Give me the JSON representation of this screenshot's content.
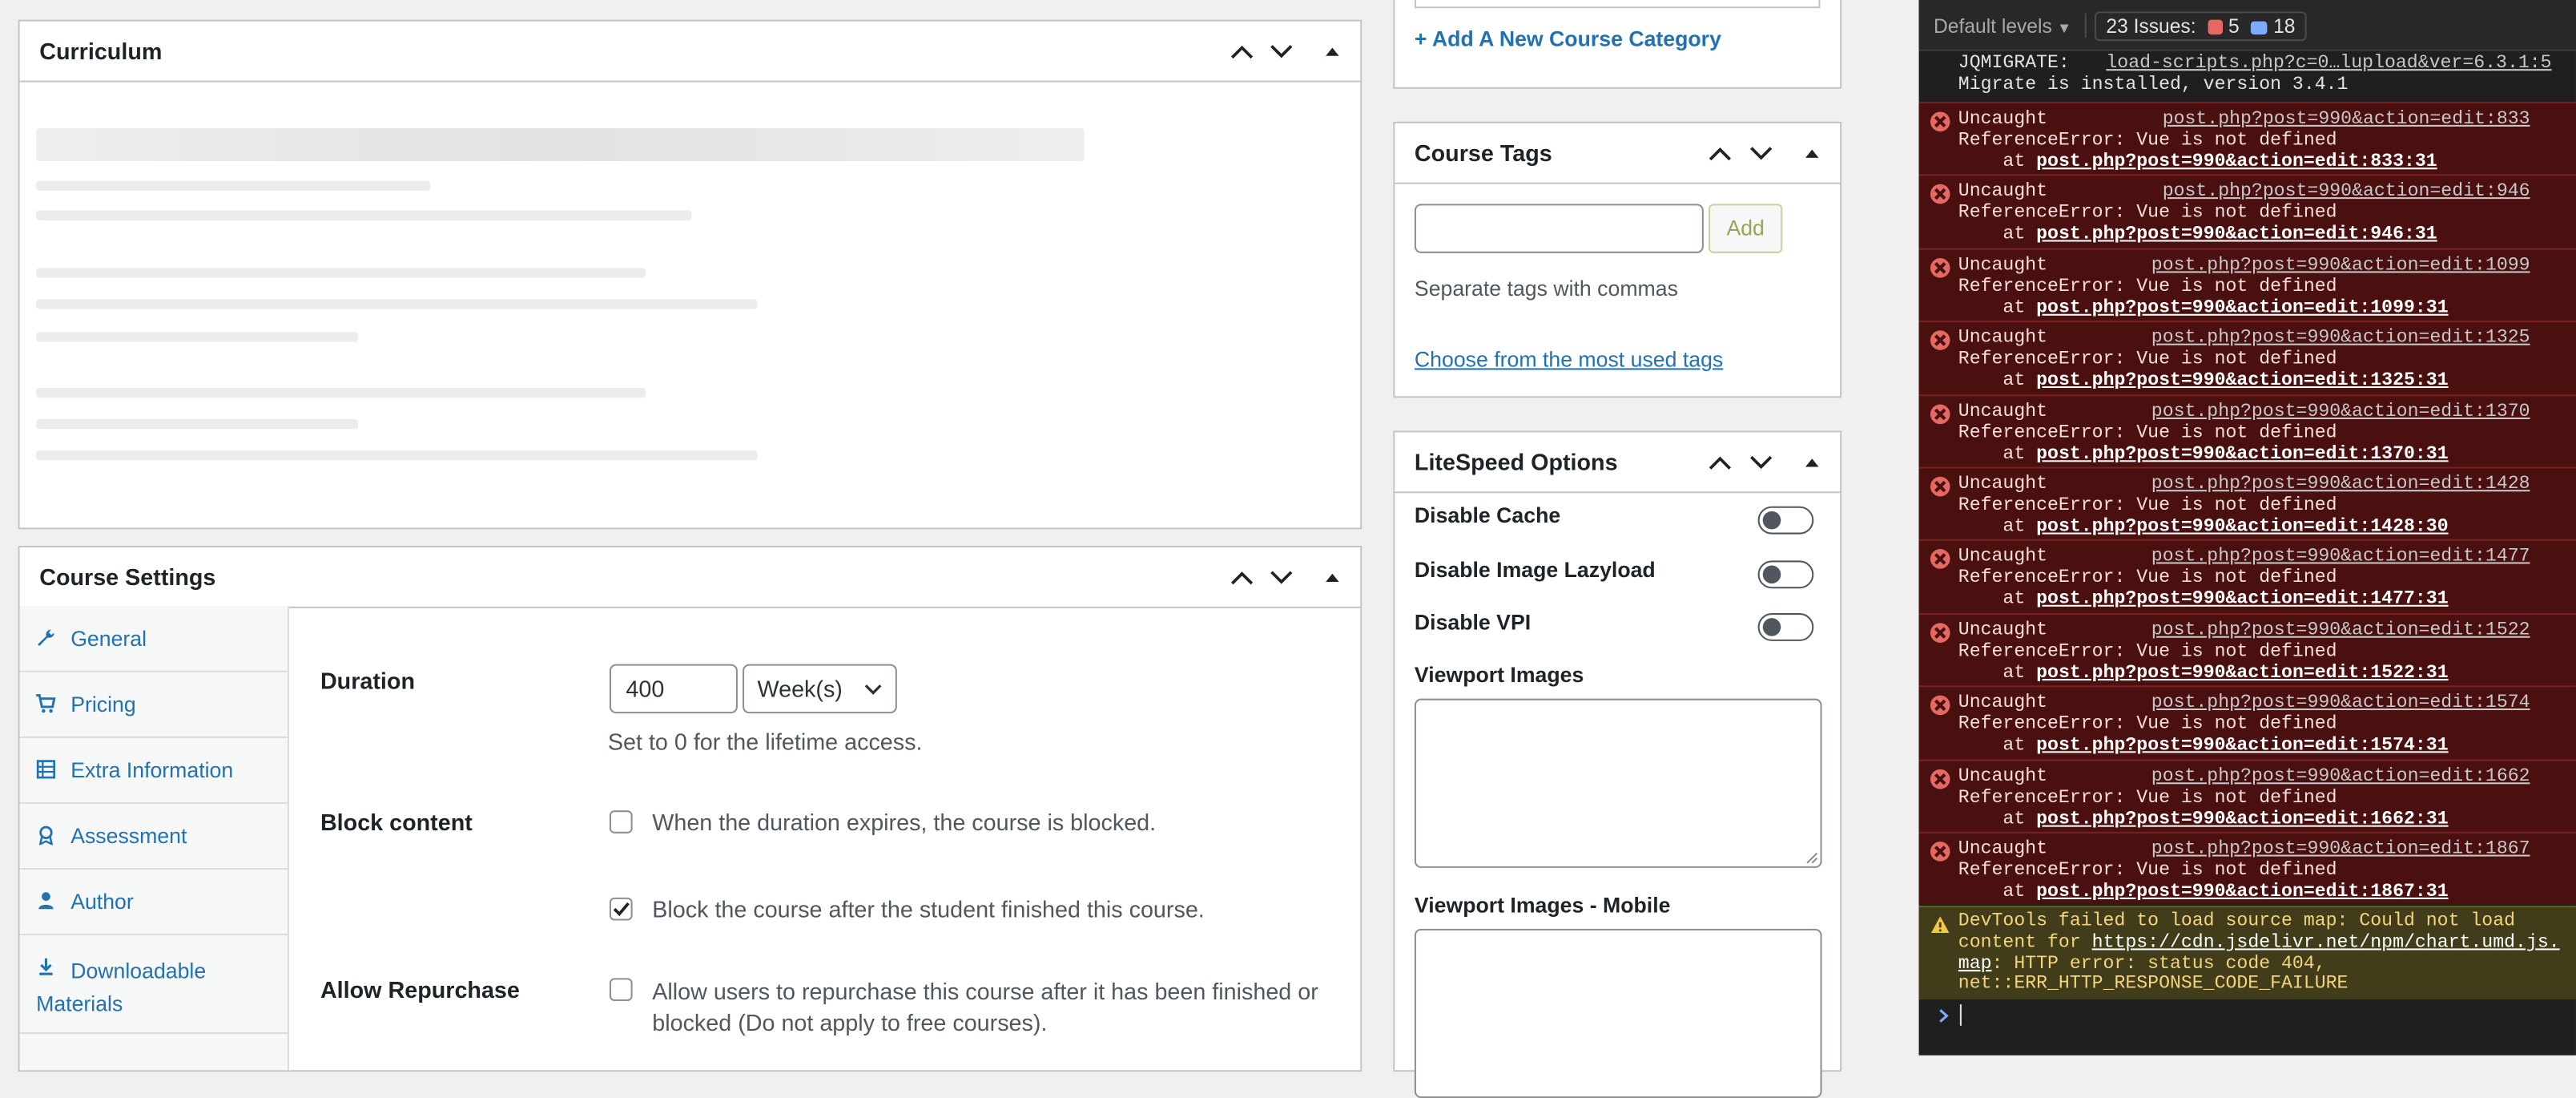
{
  "curriculum": {
    "title": "Curriculum"
  },
  "course_settings": {
    "title": "Course Settings",
    "tabs": [
      {
        "label": "General",
        "icon": "wrench-icon"
      },
      {
        "label": "Pricing",
        "icon": "cart-icon"
      },
      {
        "label": "Extra Information",
        "icon": "list-icon"
      },
      {
        "label": "Assessment",
        "icon": "award-icon"
      },
      {
        "label": "Author",
        "icon": "user-icon"
      },
      {
        "label": "Downloadable Materials",
        "icon": "download-icon"
      }
    ],
    "duration": {
      "label": "Duration",
      "value": "400",
      "unit": "Week(s)",
      "hint": "Set to 0 for the lifetime access."
    },
    "block_content": {
      "label": "Block content",
      "option1": "When the duration expires, the course is blocked.",
      "option1_checked": false,
      "option2": "Block the course after the student finished this course.",
      "option2_checked": true
    },
    "allow_repurchase": {
      "label": "Allow Repurchase",
      "text": "Allow users to repurchase this course after it has been finished or blocked (Do not apply to free courses).",
      "checked": false
    }
  },
  "category": {
    "add_link": "+ Add A New Course Category"
  },
  "course_tags": {
    "title": "Course Tags",
    "input_value": "",
    "add_button": "Add",
    "hint": "Separate tags with commas",
    "choose_link": "Choose from the most used tags"
  },
  "litespeed": {
    "title": "LiteSpeed Options",
    "toggles": [
      {
        "label": "Disable Cache",
        "on": false
      },
      {
        "label": "Disable Image Lazyload",
        "on": false
      },
      {
        "label": "Disable VPI",
        "on": false
      }
    ],
    "viewport_images": "Viewport Images",
    "viewport_images_mobile": "Viewport Images - Mobile"
  },
  "devtools": {
    "levels": "Default levels",
    "issues_label": "23 Issues:",
    "errors_count": "5",
    "messages_count": "18",
    "jqmigrate_src": "load-scripts.php?c=0…luploa‌d&ver=6.3.1:5",
    "jqmigrate_line1": "JQMIGRATE:",
    "jqmigrate_line2": "Migrate is installed, version 3.4.1",
    "errors": [
      {
        "src": "post.php?post=990&action=edit:833",
        "at": "post.php?post=990&action=edit:833:31"
      },
      {
        "src": "post.php?post=990&action=edit:946",
        "at": "post.php?post=990&action=edit:946:31"
      },
      {
        "src": "post.php?post=990&action=edit:1099",
        "at": "post.php?post=990&action=edit:1099:31"
      },
      {
        "src": "post.php?post=990&action=edit:1325",
        "at": "post.php?post=990&action=edit:1325:31"
      },
      {
        "src": "post.php?post=990&action=edit:1370",
        "at": "post.php?post=990&action=edit:1370:31"
      },
      {
        "src": "post.php?post=990&action=edit:1428",
        "at": "post.php?post=990&action=edit:1428:30"
      },
      {
        "src": "post.php?post=990&action=edit:1477",
        "at": "post.php?post=990&action=edit:1477:31"
      },
      {
        "src": "post.php?post=990&action=edit:1522",
        "at": "post.php?post=990&action=edit:1522:31"
      },
      {
        "src": "post.php?post=990&action=edit:1574",
        "at": "post.php?post=990&action=edit:1574:31"
      },
      {
        "src": "post.php?post=990&action=edit:1662",
        "at": "post.php?post=990&action=edit:1662:31"
      },
      {
        "src": "post.php?post=990&action=edit:1867",
        "at": "post.php?post=990&action=edit:1867:31"
      }
    ],
    "error_line1": "Uncaught",
    "error_line2": "ReferenceError: Vue is not defined",
    "error_at_prefix": "    at ",
    "warning_line1": "DevTools failed to load source map: Could not load",
    "warning_line2_prefix": "content for ",
    "warning_url_part1": "https://cdn.jsdelivr.net/npm/chart.umd.js.",
    "warning_url_part2": "map",
    "warning_line3_suffix": ": HTTP error: status code 404,",
    "warning_line4": "net::ERR_HTTP_RESPONSE_CODE_FAILURE",
    "colors": {
      "error_bg": "#4a0f0f",
      "warning_bg": "#413c1a",
      "accent": "#2271b1"
    }
  }
}
